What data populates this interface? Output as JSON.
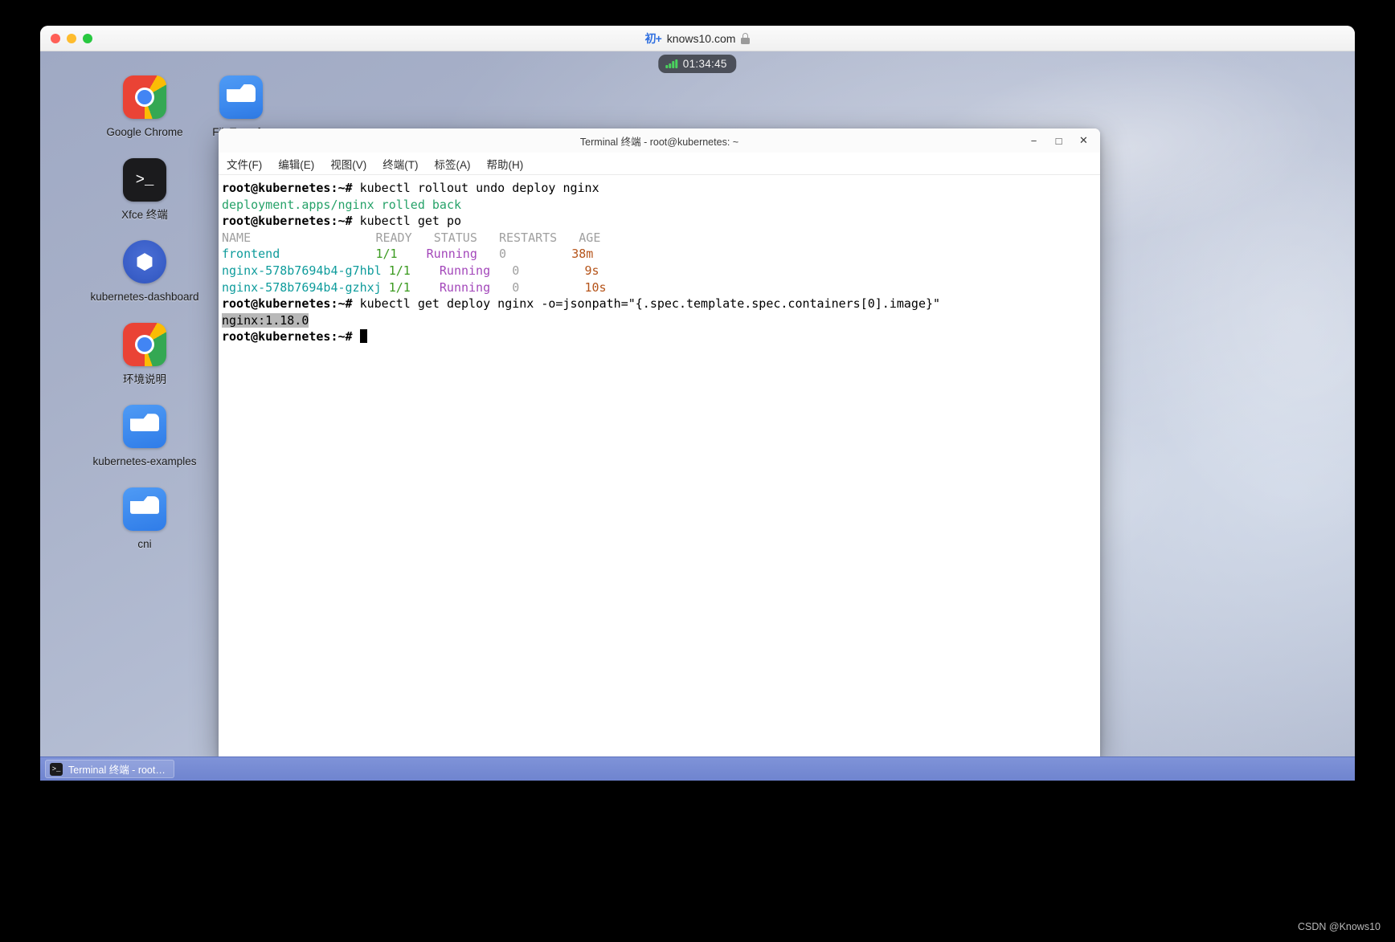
{
  "browser": {
    "badge": "初+",
    "url": "knows10.com",
    "lock_icon": "lock-icon",
    "traffic_lights": [
      "close",
      "minimize",
      "zoom"
    ]
  },
  "clock_pill": {
    "signal_icon": "signal-bars-icon",
    "time": "01:34:45"
  },
  "desktop": {
    "icons": [
      {
        "label": "Google Chrome",
        "icon": "chrome-icon"
      },
      {
        "label": "FileTransfer",
        "icon": "folder-icon"
      },
      {
        "label": "Xfce 终端",
        "icon": "terminal-icon"
      },
      {
        "label": "kubernetes-dashboard",
        "icon": "kubernetes-icon"
      },
      {
        "label": "环境说明",
        "icon": "chrome-icon"
      },
      {
        "label": "kubernetes-examples",
        "icon": "folder-icon"
      },
      {
        "label": "cni",
        "icon": "folder-icon"
      }
    ]
  },
  "terminal": {
    "title": "Terminal 终端 - root@kubernetes: ~",
    "window_buttons": {
      "minimize": "−",
      "maximize": "□",
      "close": "✕"
    },
    "menu": [
      "文件(F)",
      "编辑(E)",
      "视图(V)",
      "终端(T)",
      "标签(A)",
      "帮助(H)"
    ],
    "prompt": "root@kubernetes:~# ",
    "lines": {
      "cmd1": "kubectl rollout undo deploy nginx",
      "out1": "deployment.apps/nginx rolled back",
      "cmd2": "kubectl get po",
      "cmd3": "kubectl get deploy nginx -o=jsonpath=\"{.spec.template.spec.containers[0].image}\"",
      "out3": "nginx:1.18.0"
    },
    "pods_table": {
      "headers": [
        "NAME",
        "READY",
        "STATUS",
        "RESTARTS",
        "AGE"
      ],
      "rows": [
        {
          "name": "frontend",
          "ready": "1/1",
          "status": "Running",
          "restarts": "0",
          "age": "38m"
        },
        {
          "name": "nginx-578b7694b4-g7hbl",
          "ready": "1/1",
          "status": "Running",
          "restarts": "0",
          "age": "9s"
        },
        {
          "name": "nginx-578b7694b4-gzhxj",
          "ready": "1/1",
          "status": "Running",
          "restarts": "0",
          "age": "10s"
        }
      ]
    },
    "colors": {
      "prompt": "#000000",
      "success": "#26a269",
      "header": "#a0a0a0",
      "pod_name": "#0f9c9c",
      "ready": "#3a9a1f",
      "status": "#a347ba",
      "age": "#b5541a",
      "selection_bg": "#b8b8b8"
    }
  },
  "taskbar": {
    "task_label": "Terminal 终端 - root…",
    "task_icon": "terminal-icon"
  },
  "watermark": "CSDN @Knows10"
}
